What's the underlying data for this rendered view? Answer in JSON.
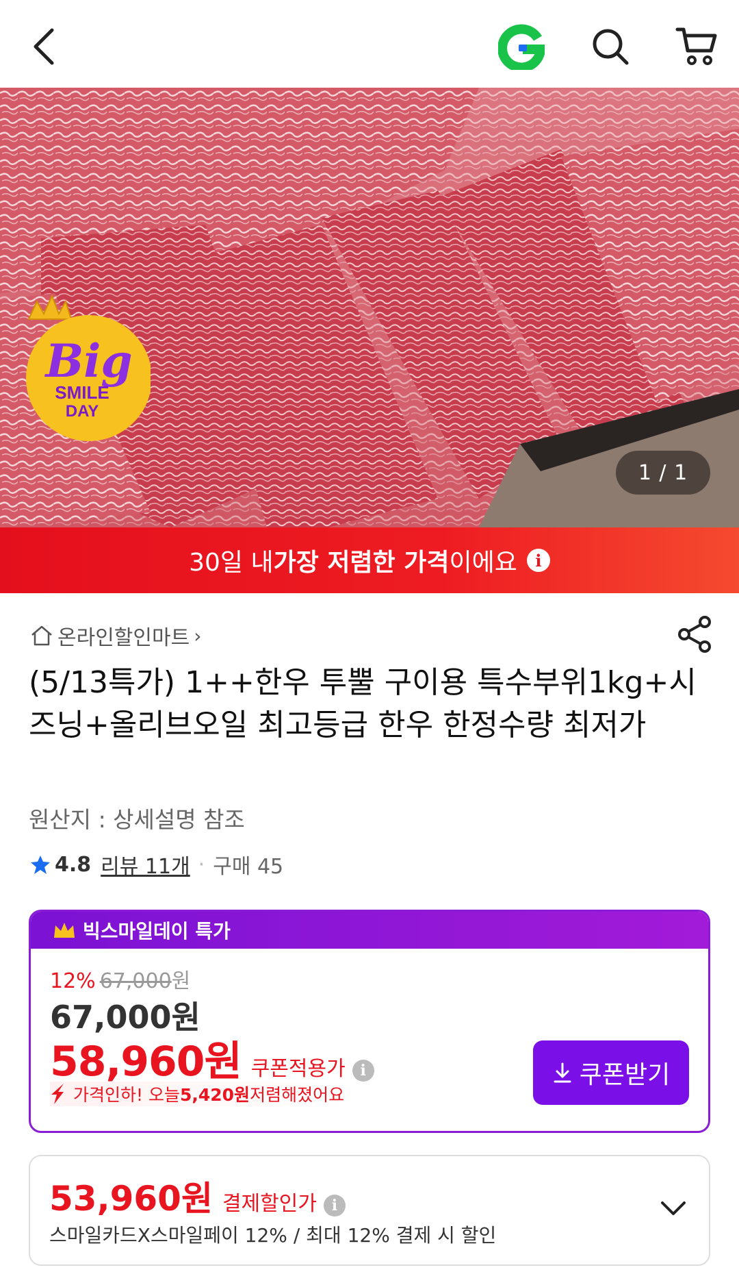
{
  "hero": {
    "counter": "1 / 1",
    "badge_big": "Big",
    "badge_line1": "SMILE",
    "badge_line2": "DAY"
  },
  "banner": {
    "pre": "30일 내 ",
    "bold": "가장 저렴한 가격",
    "post": "이에요"
  },
  "seller": {
    "name": "온라인할인마트"
  },
  "product": {
    "title": "(5/13특가) 1++한우 투뿔 구이용 특수부위1kg+시즈닝+올리브오일 최고등급 한우 한정수량 최저가",
    "origin": "원산지 : 상세설명 참조",
    "rating": "4.8",
    "reviews": "리뷰 11개",
    "purchases": "구매 45"
  },
  "promo": {
    "header": "빅스마일데이 특가",
    "discount_pct": "12%",
    "original_price": "67,000",
    "won": "원",
    "price": "67,000원",
    "coupon_price": "58,960원",
    "coupon_price_label": "쿠폰적용가",
    "pricedown_pre": "가격인하! 오늘 ",
    "pricedown_amount": "5,420원",
    "pricedown_post": " 저렴해졌어요",
    "coupon_button": "쿠폰받기"
  },
  "payment": {
    "price": "53,960원",
    "label": "결제할인가",
    "desc": "스마일카드X스마일페이 12% / 최대 12% 결제 시 할인"
  },
  "colors": {
    "accent_red": "#e8141f",
    "accent_purple": "#7b0fe8",
    "g_logo_green": "#19c34a"
  }
}
